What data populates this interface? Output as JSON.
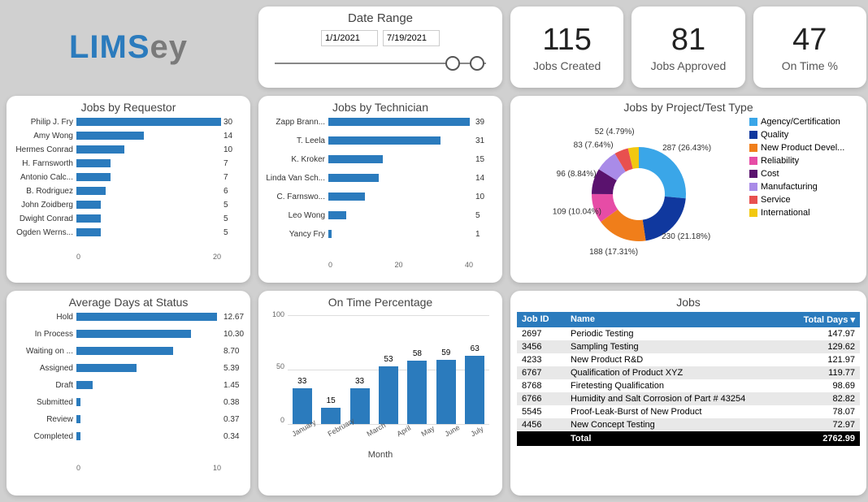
{
  "logo": {
    "part1": "LIMS",
    "part2": "ey"
  },
  "daterange": {
    "title": "Date Range",
    "from": "1/1/2021",
    "to": "7/19/2021"
  },
  "kpis": [
    {
      "value": "115",
      "label": "Jobs Created"
    },
    {
      "value": "81",
      "label": "Jobs Approved"
    },
    {
      "value": "47",
      "label": "On Time %"
    }
  ],
  "req": {
    "title": "Jobs by Requestor",
    "max": 30,
    "ticks": [
      "0",
      "20"
    ],
    "rows": [
      [
        "Philip J. Fry",
        30
      ],
      [
        "Amy Wong",
        14
      ],
      [
        "Hermes Conrad",
        10
      ],
      [
        "H. Farnsworth",
        7
      ],
      [
        "Antonio Calc...",
        7
      ],
      [
        "B. Rodriguez",
        6
      ],
      [
        "John Zoidberg",
        5
      ],
      [
        "Dwight Conrad",
        5
      ],
      [
        "Ogden Werns...",
        5
      ]
    ]
  },
  "tech": {
    "title": "Jobs by Technician",
    "max": 40,
    "ticks": [
      "0",
      "20",
      "40"
    ],
    "rows": [
      [
        "Zapp Brann...",
        39
      ],
      [
        "T. Leela",
        31
      ],
      [
        "K. Kroker",
        15
      ],
      [
        "Linda Van Sch...",
        14
      ],
      [
        "C. Farnswo...",
        10
      ],
      [
        "Leo Wong",
        5
      ],
      [
        "Yancy Fry",
        1
      ]
    ]
  },
  "pie": {
    "title": "Jobs by Project/Test Type",
    "slices": [
      {
        "name": "Agency/Certification",
        "value": 287,
        "pct": "26.43%",
        "color": "#3aa6e8"
      },
      {
        "name": "Quality",
        "value": 230,
        "pct": "21.18%",
        "color": "#10389e"
      },
      {
        "name": "New Product Devel...",
        "value": 188,
        "pct": "17.31%",
        "color": "#f07e1a"
      },
      {
        "name": "Reliability",
        "value": 109,
        "pct": "10.04%",
        "color": "#e64ca6"
      },
      {
        "name": "Cost",
        "value": 96,
        "pct": "8.84%",
        "color": "#5a126e"
      },
      {
        "name": "Manufacturing",
        "value": 83,
        "pct": "7.64%",
        "color": "#a98be8"
      },
      {
        "name": "Service",
        "value": 52,
        "pct": "4.79%",
        "color": "#e8504f"
      },
      {
        "name": "International",
        "value": 40,
        "pct": "",
        "color": "#f2c80f"
      }
    ]
  },
  "status": {
    "title": "Average Days at Status",
    "max": 13,
    "ticks": [
      "0",
      "10"
    ],
    "rows": [
      [
        "Hold",
        "12.67"
      ],
      [
        "In Process",
        "10.30"
      ],
      [
        "Waiting on ...",
        "8.70"
      ],
      [
        "Assigned",
        "5.39"
      ],
      [
        "Draft",
        "1.45"
      ],
      [
        "Submitted",
        "0.38"
      ],
      [
        "Review",
        "0.37"
      ],
      [
        "Completed",
        "0.34"
      ]
    ]
  },
  "ontime": {
    "title": "On Time Percentage",
    "ylabels": [
      "0",
      "50",
      "100"
    ],
    "xlabel": "Month",
    "bars": [
      [
        "January",
        33
      ],
      [
        "February",
        15
      ],
      [
        "March",
        33
      ],
      [
        "April",
        53
      ],
      [
        "May",
        58
      ],
      [
        "June",
        59
      ],
      [
        "July",
        63
      ]
    ]
  },
  "jobs": {
    "title": "Jobs",
    "cols": [
      "Job ID",
      "Name",
      "Total Days"
    ],
    "totalLabel": "Total",
    "total": "2762.99",
    "rows": [
      [
        "2697",
        "Periodic Testing",
        "147.97"
      ],
      [
        "3456",
        "Sampling Testing",
        "129.62"
      ],
      [
        "4233",
        "New Product R&D",
        "121.97"
      ],
      [
        "6767",
        "Qualification of Product XYZ",
        "119.77"
      ],
      [
        "8768",
        "Firetesting Qualification",
        "98.69"
      ],
      [
        "6766",
        "Humidity and Salt Corrosion of Part # 43254",
        "82.82"
      ],
      [
        "5545",
        "Proof-Leak-Burst of New Product",
        "78.07"
      ],
      [
        "4456",
        "New Concept Testing",
        "72.97"
      ]
    ]
  },
  "chart_data": [
    {
      "type": "bar",
      "title": "Jobs by Requestor",
      "orientation": "horizontal",
      "categories": [
        "Philip J. Fry",
        "Amy Wong",
        "Hermes Conrad",
        "H. Farnsworth",
        "Antonio Calc...",
        "B. Rodriguez",
        "John Zoidberg",
        "Dwight Conrad",
        "Ogden Werns..."
      ],
      "values": [
        30,
        14,
        10,
        7,
        7,
        6,
        5,
        5,
        5
      ],
      "xlim": [
        0,
        30
      ]
    },
    {
      "type": "bar",
      "title": "Jobs by Technician",
      "orientation": "horizontal",
      "categories": [
        "Zapp Brann...",
        "T. Leela",
        "K. Kroker",
        "Linda Van Sch...",
        "C. Farnswo...",
        "Leo Wong",
        "Yancy Fry"
      ],
      "values": [
        39,
        31,
        15,
        14,
        10,
        5,
        1
      ],
      "xlim": [
        0,
        40
      ]
    },
    {
      "type": "pie",
      "title": "Jobs by Project/Test Type",
      "categories": [
        "Agency/Certification",
        "Quality",
        "New Product Development",
        "Reliability",
        "Cost",
        "Manufacturing",
        "Service",
        "International"
      ],
      "values": [
        287,
        230,
        188,
        109,
        96,
        83,
        52,
        40
      ]
    },
    {
      "type": "bar",
      "title": "Average Days at Status",
      "orientation": "horizontal",
      "categories": [
        "Hold",
        "In Process",
        "Waiting on ...",
        "Assigned",
        "Draft",
        "Submitted",
        "Review",
        "Completed"
      ],
      "values": [
        12.67,
        10.3,
        8.7,
        5.39,
        1.45,
        0.38,
        0.37,
        0.34
      ],
      "xlim": [
        0,
        13
      ]
    },
    {
      "type": "bar",
      "title": "On Time Percentage",
      "xlabel": "Month",
      "categories": [
        "January",
        "February",
        "March",
        "April",
        "May",
        "June",
        "July"
      ],
      "values": [
        33,
        15,
        33,
        53,
        58,
        59,
        63
      ],
      "ylim": [
        0,
        100
      ]
    },
    {
      "type": "table",
      "title": "Jobs",
      "columns": [
        "Job ID",
        "Name",
        "Total Days"
      ],
      "rows": [
        [
          "2697",
          "Periodic Testing",
          147.97
        ],
        [
          "3456",
          "Sampling Testing",
          129.62
        ],
        [
          "4233",
          "New Product R&D",
          121.97
        ],
        [
          "6767",
          "Qualification of Product XYZ",
          119.77
        ],
        [
          "8768",
          "Firetesting Qualification",
          98.69
        ],
        [
          "6766",
          "Humidity and Salt Corrosion of Part # 43254",
          82.82
        ],
        [
          "5545",
          "Proof-Leak-Burst of New Product",
          78.07
        ],
        [
          "4456",
          "New Concept Testing",
          72.97
        ]
      ],
      "total": 2762.99
    }
  ]
}
